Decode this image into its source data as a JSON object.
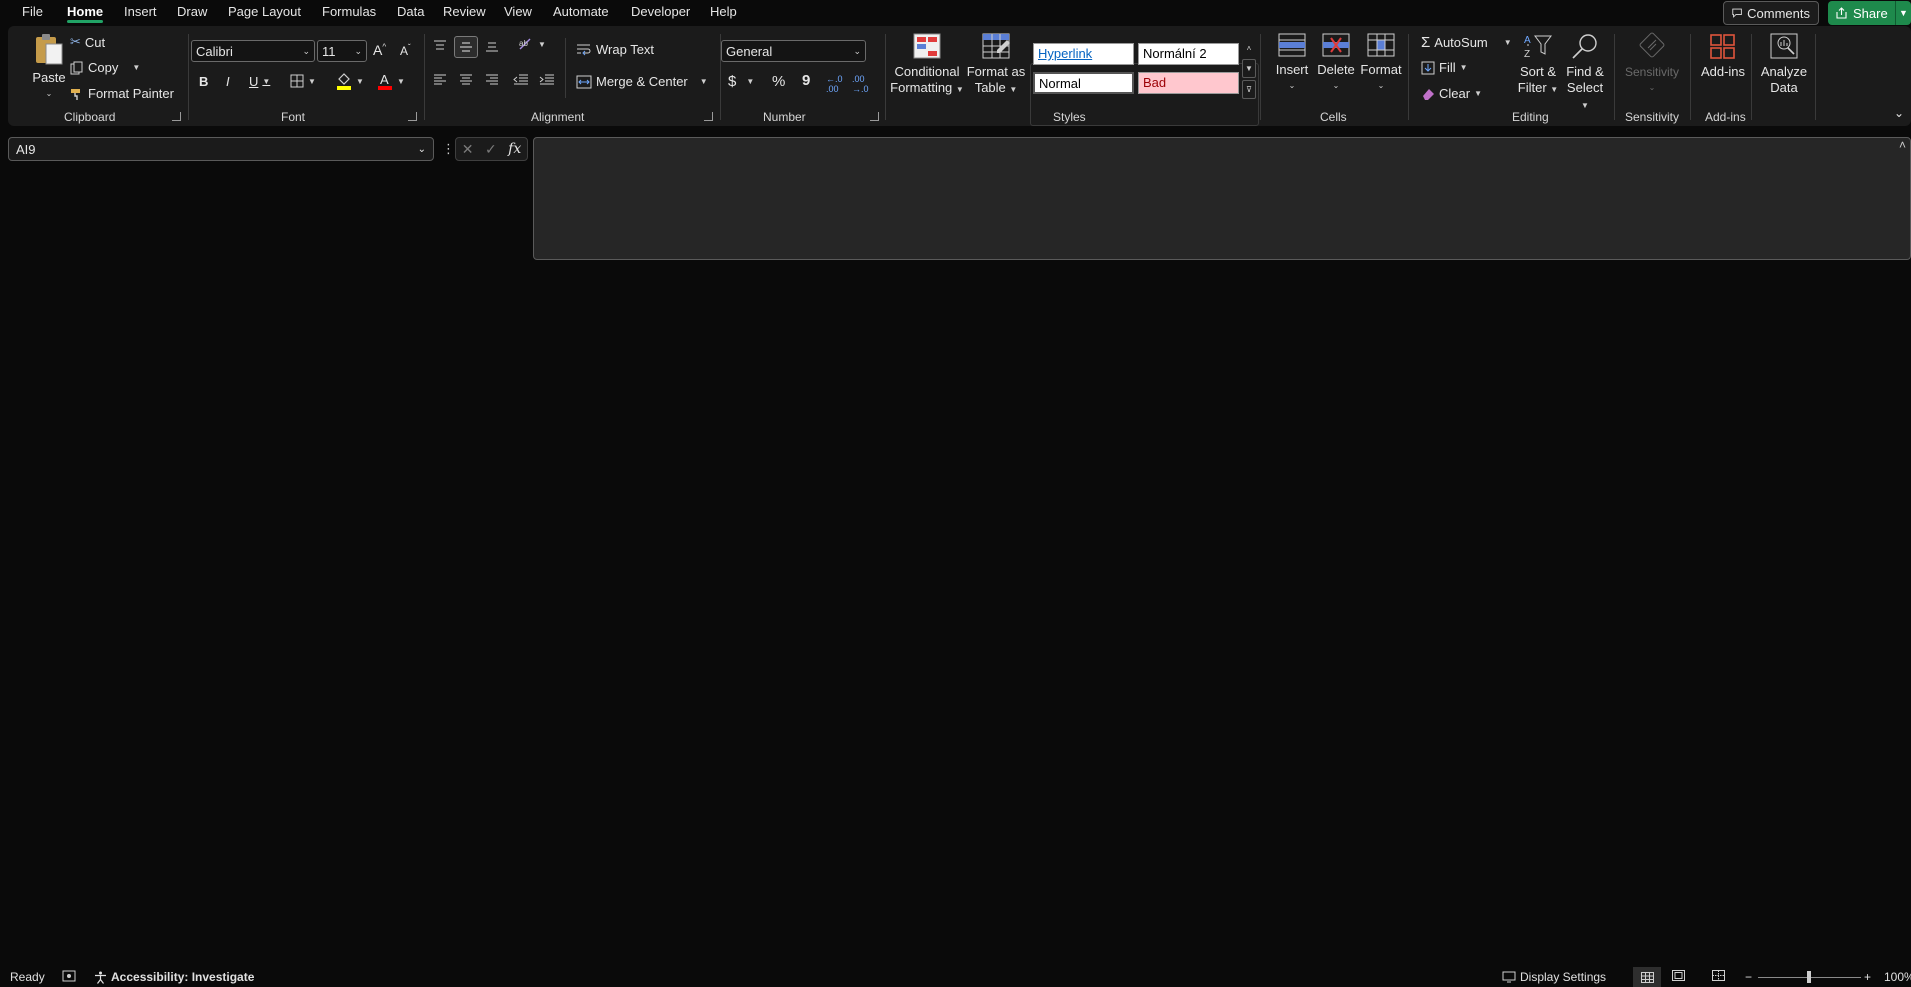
{
  "menu": {
    "tabs": [
      "File",
      "Home",
      "Insert",
      "Draw",
      "Page Layout",
      "Formulas",
      "Data",
      "Review",
      "View",
      "Automate",
      "Developer",
      "Help"
    ],
    "active_tab": "Home",
    "comments_label": "Comments",
    "share_label": "Share"
  },
  "ribbon": {
    "clipboard": {
      "group_label": "Clipboard",
      "paste": "Paste",
      "cut": "Cut",
      "copy": "Copy",
      "format_painter": "Format Painter"
    },
    "font": {
      "group_label": "Font",
      "font_name": "Calibri",
      "font_size": "11",
      "bold": "B",
      "italic": "I",
      "underline": "U",
      "fill_color": "#ffff00",
      "font_color": "#ff0000"
    },
    "alignment": {
      "group_label": "Alignment",
      "wrap_text": "Wrap Text",
      "merge_center": "Merge & Center"
    },
    "number": {
      "group_label": "Number",
      "format": "General",
      "currency": "$",
      "percent": "%",
      "comma": "9"
    },
    "styles": {
      "group_label": "Styles",
      "conditional_formatting": [
        "Conditional",
        "Formatting"
      ],
      "format_as_table": [
        "Format as",
        "Table"
      ],
      "gallery": {
        "hyperlink": "Hyperlink",
        "normalni2": "Normální 2",
        "normal": "Normal",
        "bad": "Bad"
      }
    },
    "cells": {
      "group_label": "Cells",
      "insert": "Insert",
      "delete": "Delete",
      "format": "Format"
    },
    "editing": {
      "group_label": "Editing",
      "autosum": "AutoSum",
      "fill": "Fill",
      "clear": "Clear",
      "sort_filter": [
        "Sort &",
        "Filter"
      ],
      "find_select": [
        "Find &",
        "Select"
      ]
    },
    "sensitivity": {
      "group_label": "Sensitivity",
      "button": "Sensitivity"
    },
    "addins": {
      "group_label": "Add-ins",
      "addins_button": "Add-ins",
      "analyze": [
        "Analyze",
        "Data"
      ]
    }
  },
  "formula_bar": {
    "name_box": "AI9",
    "fx": "fx",
    "formula": ""
  },
  "status_bar": {
    "ready": "Ready",
    "accessibility": "Accessibility: Investigate",
    "display_settings": "Display Settings",
    "zoom": "100%",
    "zoom_minus": "−",
    "zoom_plus": "+"
  },
  "colors": {
    "accent_green": "#21a366",
    "share_green": "#1e8a4c",
    "bad_bg": "#ffc7ce",
    "bad_text": "#9c0006",
    "hyperlink": "#0563c1"
  }
}
